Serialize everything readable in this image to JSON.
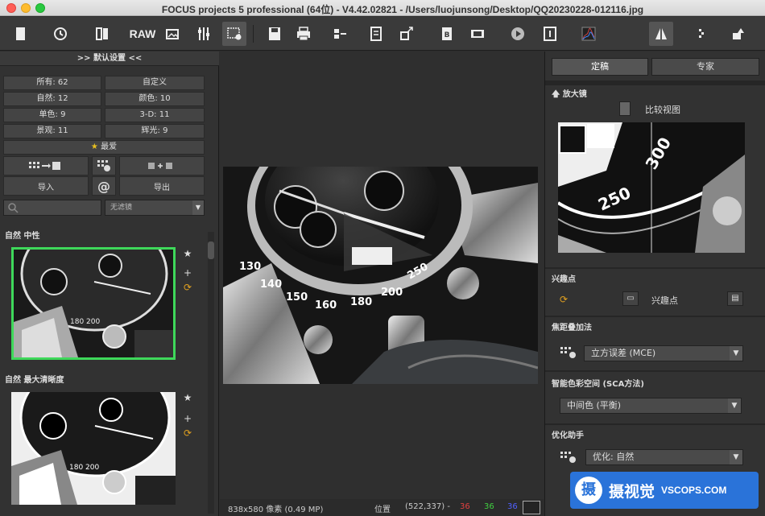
{
  "window": {
    "title": "FOCUS projects 5 professional (64位) - V4.42.02821 - /Users/luojunsong/Desktop/QQ20230228-012116.jpg"
  },
  "toolbar": {
    "raw_label": "RAW",
    "icons": [
      "new-doc-icon",
      "history-icon",
      "book-icon",
      "raw-icon",
      "image-export-icon",
      "tools-icon",
      "settings-grid-icon",
      "save-icon",
      "print-icon",
      "stack-icon",
      "import-icon",
      "upload-icon",
      "pdf-icon",
      "film-icon",
      "play-icon",
      "info-icon",
      "histogram-icon",
      "compare-icon",
      "split-icon",
      "export-icon"
    ]
  },
  "left": {
    "header": ">> 默认设置 <<",
    "categories": [
      {
        "label": "所有: 62"
      },
      {
        "label": "自定义"
      },
      {
        "label": "自然: 12"
      },
      {
        "label": "颜色: 10"
      },
      {
        "label": "单色: 9"
      },
      {
        "label": "3-D: 11"
      },
      {
        "label": "景观: 11"
      },
      {
        "label": "辉光: 9"
      }
    ],
    "favorite": "最爱",
    "import_label": "导入",
    "export_label": "导出",
    "filter_placeholder": "",
    "filter_select": "无滤镜",
    "groups": [
      {
        "label": "自然 中性"
      },
      {
        "label": "自然 最大清晰度"
      }
    ]
  },
  "status": {
    "dimensions": "838x580 像素 (0.49 MP)",
    "position_label": "位置",
    "position_value": "(522,337) -",
    "r": "36",
    "g": "36",
    "b": "36",
    "color_r": "#e04040",
    "color_g": "#40d040",
    "color_b": "#5060ff"
  },
  "right": {
    "tab_final": "定稿",
    "tab_expert": "专家",
    "magnifier_label": "放大镜",
    "compare_label": "比较视图",
    "poi_section": "兴趣点",
    "poi_button": "兴趣点",
    "stacking_section": "焦距叠加法",
    "stacking_value": "立方误差 (MCE)",
    "sca_section": "智能色彩空间 (SCA方法)",
    "sca_value": "中间色 (平衡)",
    "optimizer_section": "优化助手",
    "optimizer_value": "优化: 自然"
  },
  "watermark": {
    "logo": "摄",
    "cn": "摄视觉",
    "en": "VSCOPS.COM"
  }
}
